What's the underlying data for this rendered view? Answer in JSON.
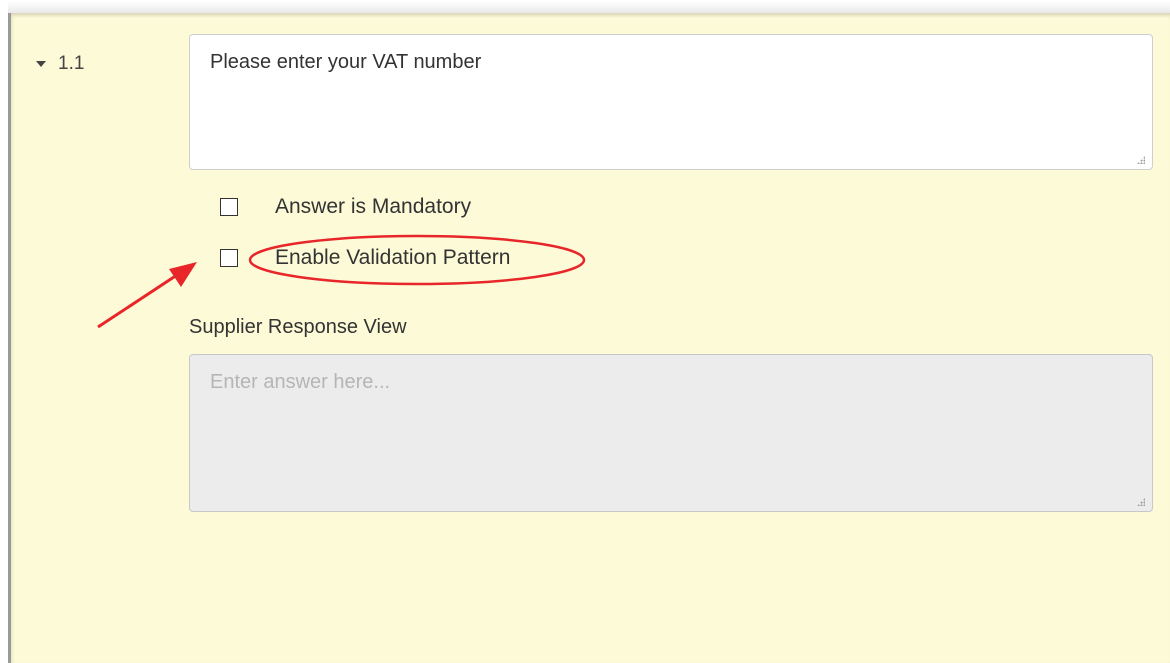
{
  "question": {
    "number": "1.1",
    "text": "Please enter your VAT number"
  },
  "options": [
    {
      "label": "Answer is Mandatory",
      "checked": false
    },
    {
      "label": "Enable Validation Pattern",
      "checked": false
    }
  ],
  "supplier_view": {
    "label": "Supplier Response View",
    "placeholder": "Enter answer here..."
  },
  "colors": {
    "panel_background": "#fdfbd7",
    "annotation_red": "#e8262a",
    "readonly_field": "#ececec"
  }
}
